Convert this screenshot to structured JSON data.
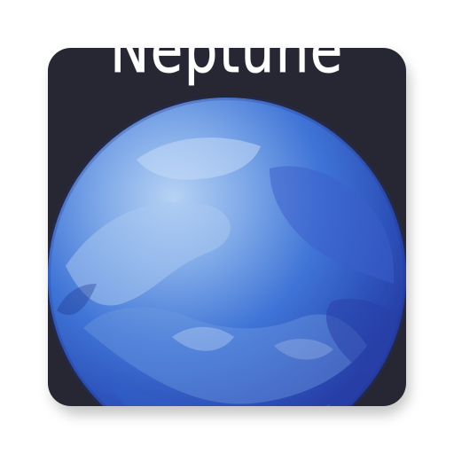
{
  "app_icon": {
    "title": "Neptune",
    "colors": {
      "background": "#262733",
      "planet_base": "#3f74d6",
      "planet_light": "#9ac0ee",
      "planet_deep": "#263ea6"
    }
  },
  "icons": {
    "planet": "neptune-planet-icon"
  }
}
